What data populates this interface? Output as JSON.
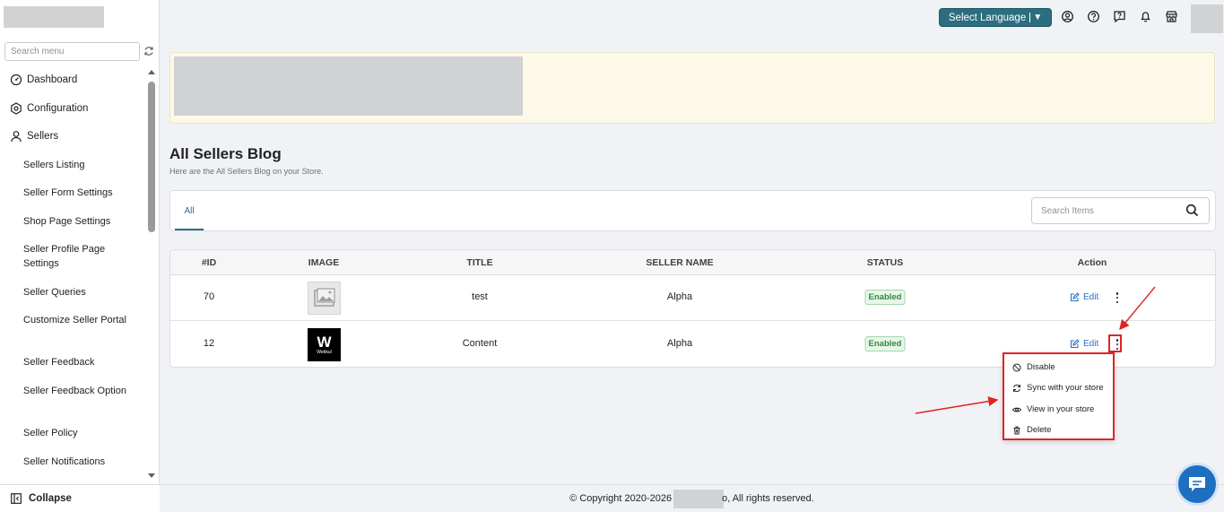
{
  "sidebar": {
    "search_placeholder": "Search menu",
    "top_items": [
      {
        "label": "Dashboard",
        "icon": "dashboard-icon"
      },
      {
        "label": "Configuration",
        "icon": "gear-icon"
      },
      {
        "label": "Sellers",
        "icon": "user-icon"
      }
    ],
    "sub_items": [
      "Sellers Listing",
      "Seller Form Settings",
      "Shop Page Settings",
      "Seller Profile Page Settings",
      "Seller Queries",
      "Customize Seller Portal",
      "Seller Feedback",
      "Seller Feedback Option",
      "Seller Policy",
      "Seller Notifications"
    ],
    "collapse_label": "Collapse"
  },
  "topbar": {
    "language_label": "Select Language",
    "language_caret": "▼",
    "icons": [
      "account-icon",
      "help-icon",
      "feedback-icon",
      "bell-icon",
      "store-icon"
    ]
  },
  "page": {
    "title": "All Sellers Blog",
    "subtitle": "Here are the All Sellers Blog on your Store."
  },
  "tabs": [
    {
      "label": "All",
      "active": true
    }
  ],
  "search": {
    "placeholder": "Search Items"
  },
  "table": {
    "columns": [
      "#ID",
      "IMAGE",
      "TITLE",
      "SELLER NAME",
      "STATUS",
      "Action"
    ],
    "rows": [
      {
        "id": "70",
        "image": "placeholder-image",
        "title": "test",
        "seller": "Alpha",
        "status": "Enabled",
        "edit": "Edit"
      },
      {
        "id": "12",
        "image": "webkul-logo",
        "title": "Content",
        "seller": "Alpha",
        "status": "Enabled",
        "edit": "Edit"
      }
    ],
    "logo_text": "W",
    "logo_subtext": "Webkul"
  },
  "action_menu": [
    {
      "label": "Disable",
      "icon": "disable-icon"
    },
    {
      "label": "Sync with your store",
      "icon": "sync-icon"
    },
    {
      "label": "View in your store",
      "icon": "eye-icon"
    },
    {
      "label": "Delete",
      "icon": "trash-icon"
    }
  ],
  "footer": {
    "prefix": "© Copyright 2020-2026",
    "suffix": "o, All rights reserved."
  },
  "colors": {
    "accent": "#2c6e7f",
    "highlight": "#e02424",
    "status_green": "#2e8b3b",
    "link_blue": "#2c6ecb"
  }
}
